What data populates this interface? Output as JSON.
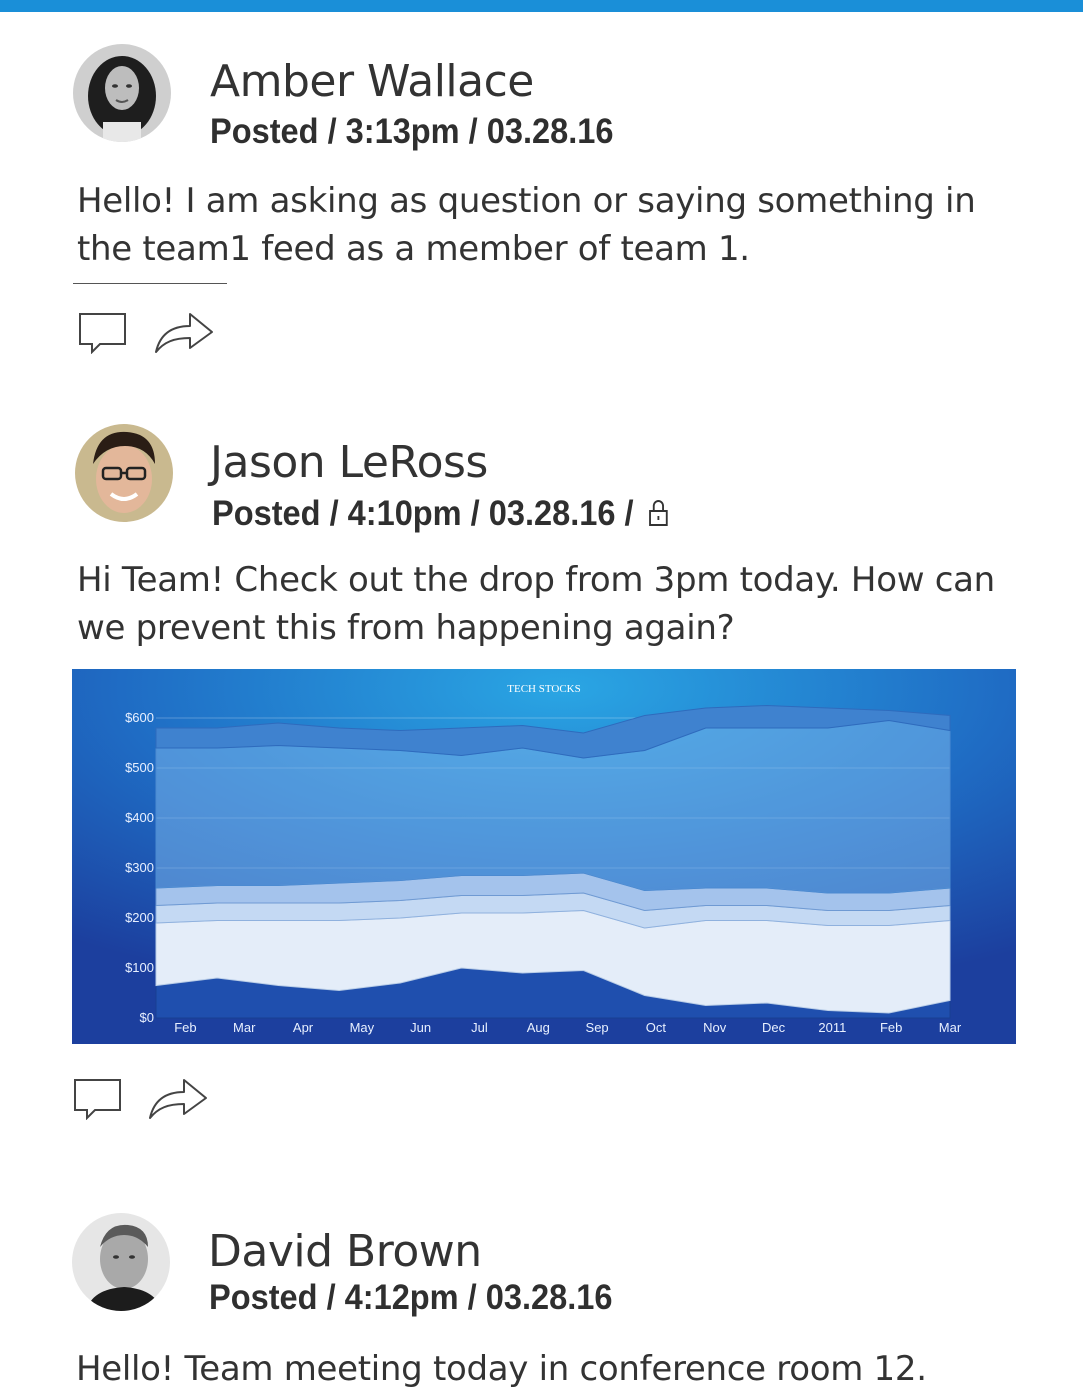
{
  "feed": {
    "posts": [
      {
        "author": "Amber Wallace",
        "meta": "Posted / 3:13pm / 03.28.16",
        "text": "Hello! I am asking as question or saying something in the team1 feed as a member of team 1."
      },
      {
        "author": "Jason LeRoss",
        "meta": "Posted / 4:10pm / 03.28.16 /",
        "locked": true,
        "text": "Hi Team! Check out the drop from 3pm today. How can we prevent this from happening again?"
      },
      {
        "author": "David Brown",
        "meta": "Posted / 4:12pm / 03.28.16",
        "text": "Hello! Team meeting today in conference room 12."
      }
    ],
    "actions": {
      "comment_icon": "comment-icon",
      "share_icon": "share-icon"
    },
    "colors": {
      "top_bar": "#1a8fd8",
      "chart_bg_dark": "#1c3f9e",
      "chart_bg_light": "#2aa6e4"
    }
  },
  "chart_data": {
    "type": "area",
    "title": "TECH STOCKS",
    "categories": [
      "Feb",
      "Mar",
      "Apr",
      "May",
      "Jun",
      "Jul",
      "Aug",
      "Sep",
      "Oct",
      "Nov",
      "Dec",
      "2011",
      "Feb",
      "Mar"
    ],
    "ylim": [
      0,
      600
    ],
    "yticks": [
      "$0",
      "$100",
      "$200",
      "$300",
      "$400",
      "$500",
      "$600"
    ],
    "grid": true,
    "stacked": true,
    "series": [
      {
        "values": [
          65,
          80,
          65,
          55,
          70,
          100,
          90,
          95,
          45,
          25,
          30,
          15,
          10,
          35
        ]
      },
      {
        "values": [
          125,
          115,
          130,
          140,
          130,
          110,
          120,
          120,
          135,
          170,
          165,
          170,
          175,
          160
        ]
      },
      {
        "values": [
          35,
          35,
          35,
          35,
          35,
          35,
          35,
          35,
          35,
          30,
          30,
          30,
          30,
          30
        ]
      },
      {
        "values": [
          35,
          35,
          35,
          40,
          40,
          40,
          40,
          40,
          40,
          35,
          35,
          35,
          35,
          35
        ]
      },
      {
        "values": [
          280,
          275,
          280,
          270,
          260,
          240,
          255,
          230,
          280,
          320,
          320,
          330,
          345,
          315
        ]
      },
      {
        "values": [
          40,
          40,
          45,
          40,
          40,
          55,
          45,
          50,
          70,
          40,
          45,
          40,
          20,
          30
        ]
      }
    ]
  }
}
